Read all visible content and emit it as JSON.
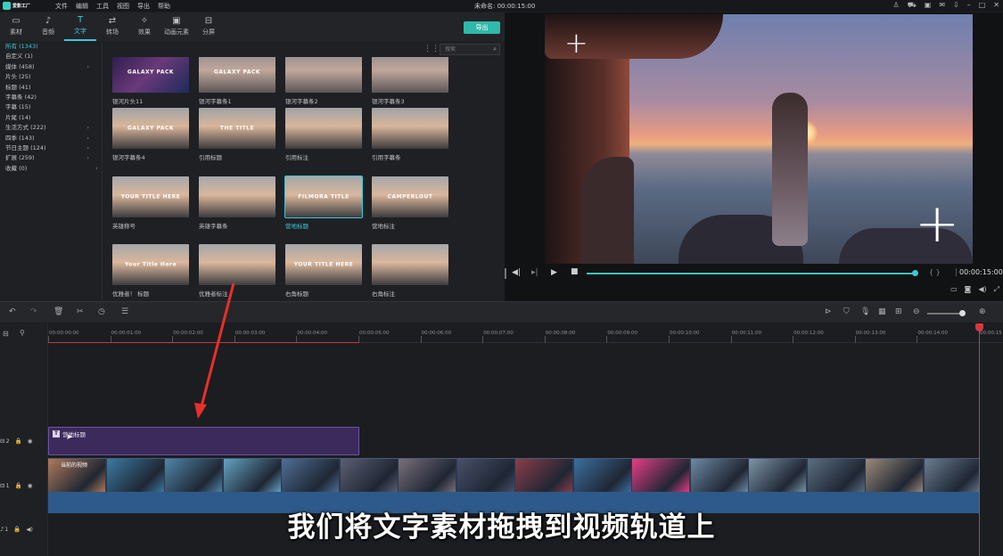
{
  "titlebar": {
    "logo_text": "爱影工厂",
    "menu": [
      "文件",
      "编辑",
      "工具",
      "视图",
      "导出",
      "帮助"
    ],
    "project_title": "未命名: 00:00:15:00"
  },
  "tabs": [
    {
      "icon": "folder-icon",
      "glyph": "▭",
      "label": "素材"
    },
    {
      "icon": "music-icon",
      "glyph": "♪",
      "label": "音频"
    },
    {
      "icon": "text-icon",
      "glyph": "T",
      "label": "文字",
      "active": true
    },
    {
      "icon": "transition-icon",
      "glyph": "⇄",
      "label": "转场"
    },
    {
      "icon": "effect-icon",
      "glyph": "✧",
      "label": "效果"
    },
    {
      "icon": "element-icon",
      "glyph": "▣",
      "label": "动画元素"
    },
    {
      "icon": "splitscreen-icon",
      "glyph": "⊟",
      "label": "分屏"
    }
  ],
  "export_label": "导出",
  "search_placeholder": "搜索",
  "categories": [
    {
      "label": "所有 (1343)",
      "active": true
    },
    {
      "label": "自定义 (1)"
    },
    {
      "label": "媒体 (458)",
      "arrow": true
    },
    {
      "label": "片头 (25)"
    },
    {
      "label": "标题 (41)"
    },
    {
      "label": "字幕条 (42)"
    },
    {
      "label": "字幕 (15)"
    },
    {
      "label": "片尾 (14)"
    },
    {
      "label": "生活方式 (222)",
      "arrow": true
    },
    {
      "label": "四季 (143)",
      "arrow": true
    },
    {
      "label": "节日主题 (124)",
      "arrow": true
    },
    {
      "label": "扩展 (259)",
      "arrow": true
    },
    {
      "label": "收藏 (0)"
    }
  ],
  "grid": [
    {
      "label": "银河片头11",
      "thumb_text": "GALAXY PACK",
      "bg": "linear-gradient(135deg,#2a1b4a,#6a3a7a 50%,#1c2a5a)"
    },
    {
      "label": "银河字幕条1",
      "thumb_text": "GALAXY PACK",
      "bg": "linear-gradient(180deg,#8d8a8e,#c2a79a 45%,#5b5658)"
    },
    {
      "label": "银河字幕条2",
      "thumb_text": "",
      "bg": "linear-gradient(180deg,#8d8a8e,#c2a79a 45%,#5b5658)"
    },
    {
      "label": "银河字幕条3",
      "thumb_text": "",
      "bg": "linear-gradient(180deg,#8d8a8e,#c2a79a 45%,#5b5658)"
    },
    {
      "label": "银河字幕条4",
      "thumb_text": "GALAXY PACK",
      "bg": "linear-gradient(180deg,#9fa3a6,#d9b59a 45%,#3c3b3d)"
    },
    {
      "label": "引用标题",
      "thumb_text": "THE TITLE",
      "bg": "linear-gradient(180deg,#9fa3a6,#d9b59a 45%,#3c3b3d)"
    },
    {
      "label": "引用标注",
      "thumb_text": "",
      "bg": "linear-gradient(180deg,#9fa3a6,#d9b59a 45%,#3c3b3d)"
    },
    {
      "label": "引用字幕条",
      "thumb_text": "",
      "bg": "linear-gradient(180deg,#9fa3a6,#d9b59a 45%,#3c3b3d)"
    },
    {
      "label": "英雄称号",
      "thumb_text": "YOUR TITLE HERE",
      "bg": "linear-gradient(180deg,#a5a7aa,#dab79c 45%,#3d3c3e)"
    },
    {
      "label": "英雄字幕条",
      "thumb_text": "",
      "bg": "linear-gradient(180deg,#a5a7aa,#dab79c 45%,#3d3c3e)"
    },
    {
      "label": "营地标题",
      "thumb_text": "FILMORA TITLE",
      "bg": "linear-gradient(180deg,#a5a7aa,#dab79c 45%,#3d3c3e)",
      "selected": true
    },
    {
      "label": "营地标注",
      "thumb_text": "CAMPERLOUT",
      "bg": "linear-gradient(180deg,#a5a7aa,#dab79c 45%,#3d3c3e)"
    },
    {
      "label": "优雅者！ 标题",
      "thumb_text": "Your Title Here",
      "bg": "linear-gradient(180deg,#a5a7aa,#dab79c 45%,#3d3c3e)"
    },
    {
      "label": "优雅者标注",
      "thumb_text": "",
      "bg": "linear-gradient(180deg,#a5a7aa,#dab79c 45%,#3d3c3e)"
    },
    {
      "label": "右角标题",
      "thumb_text": "YOUR TITLE HERE",
      "bg": "linear-gradient(180deg,#a5a7aa,#dab79c 45%,#3d3c3e)"
    },
    {
      "label": "右角标注",
      "thumb_text": "",
      "bg": "linear-gradient(180deg,#a5a7aa,#dab79c 45%,#3d3c3e)"
    }
  ],
  "preview": {
    "timecode": "00:00:15:00",
    "progress": 1.0
  },
  "ruler_labels": [
    "00:00:00:00",
    "00:00:01:00",
    "00:00:02:00",
    "00:00:03:00",
    "00:00:04:00",
    "00:00:05:00",
    "00:00:06:00",
    "00:00:07:00",
    "00:00:08:00",
    "00:00:09:00",
    "00:00:10:00",
    "00:00:11:00",
    "00:00:12:00",
    "00:00:13:00",
    "00:00:14:00",
    "00:00:15"
  ],
  "tracks": {
    "title_track": "2",
    "video_track": "1",
    "audio_track": "1",
    "title_clip_label": "营地标题",
    "video_clip_label": "当前的视频"
  },
  "subtitle": "我们将文字素材拖拽到视频轨道上",
  "colors": {
    "accent": "#3ec7d8",
    "export": "#30b9aa",
    "title_clip": "#3c2a5c",
    "audio": "#2d5a8a",
    "playhead": "#d6393c"
  }
}
